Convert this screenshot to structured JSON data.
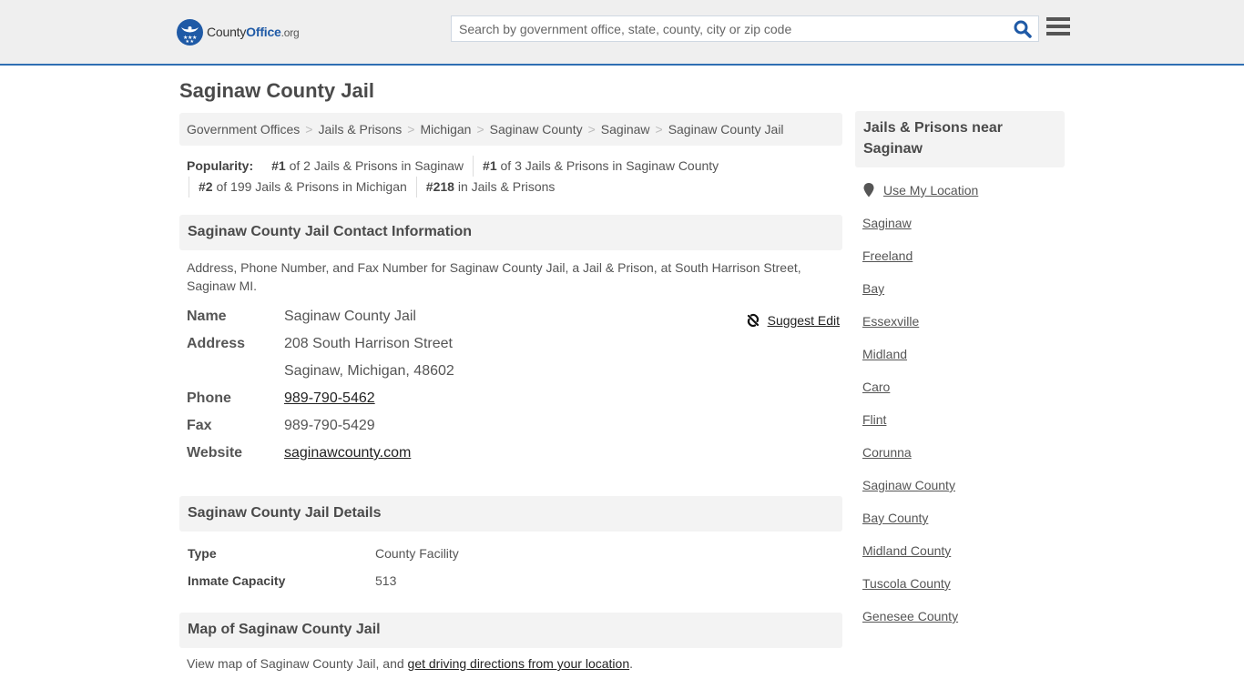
{
  "header": {
    "logo": {
      "brand_main": "County",
      "brand_accent": "Office",
      "brand_suffix": ".org"
    },
    "search": {
      "placeholder": "Search by government office, state, county, city or zip code",
      "value": ""
    },
    "search_icon": "search-icon",
    "menu_icon": "hamburger-menu-icon"
  },
  "page": {
    "title": "Saginaw County Jail"
  },
  "breadcrumb": [
    "Government Offices",
    "Jails & Prisons",
    "Michigan",
    "Saginaw County",
    "Saginaw",
    "Saginaw County Jail"
  ],
  "popularity": {
    "label": "Popularity:",
    "items": [
      {
        "rank": "#1",
        "text": " of 2 Jails & Prisons in Saginaw"
      },
      {
        "rank": "#1",
        "text": " of 3 Jails & Prisons in Saginaw County"
      },
      {
        "rank": "#2",
        "text": " of 199 Jails & Prisons in Michigan"
      },
      {
        "rank": "#218",
        "text": " in Jails & Prisons"
      }
    ]
  },
  "contact": {
    "heading": "Saginaw County Jail Contact Information",
    "description": "Address, Phone Number, and Fax Number for Saginaw County Jail, a Jail & Prison, at South Harrison Street, Saginaw MI.",
    "suggest_edit": "Suggest Edit",
    "fields": {
      "name_label": "Name",
      "name": "Saginaw County Jail",
      "address_label": "Address",
      "address_line1": "208 South Harrison Street",
      "address_line2": "Saginaw, Michigan, 48602",
      "phone_label": "Phone",
      "phone": "989-790-5462",
      "fax_label": "Fax",
      "fax": "989-790-5429",
      "website_label": "Website",
      "website": "saginawcounty.com"
    }
  },
  "details": {
    "heading": "Saginaw County Jail Details",
    "rows": [
      {
        "label": "Type",
        "value": "County Facility"
      },
      {
        "label": "Inmate Capacity",
        "value": "513"
      }
    ]
  },
  "map": {
    "heading": "Map of Saginaw County Jail",
    "text_before": "View map of Saginaw County Jail, and ",
    "link": "get driving directions from your location",
    "text_after": "."
  },
  "sidebar": {
    "heading": "Jails & Prisons near Saginaw",
    "use_location": "Use My Location",
    "links": [
      "Saginaw",
      "Freeland",
      "Bay",
      "Essexville",
      "Midland",
      "Caro",
      "Flint",
      "Corunna",
      "Saginaw County",
      "Bay County",
      "Midland County",
      "Tuscola County",
      "Genesee County"
    ]
  },
  "colors": {
    "accent": "#2f6fb3",
    "brand_blue": "#1f5aa6",
    "header_bg": "#efefef",
    "panel_bg": "#f3f3f3"
  }
}
